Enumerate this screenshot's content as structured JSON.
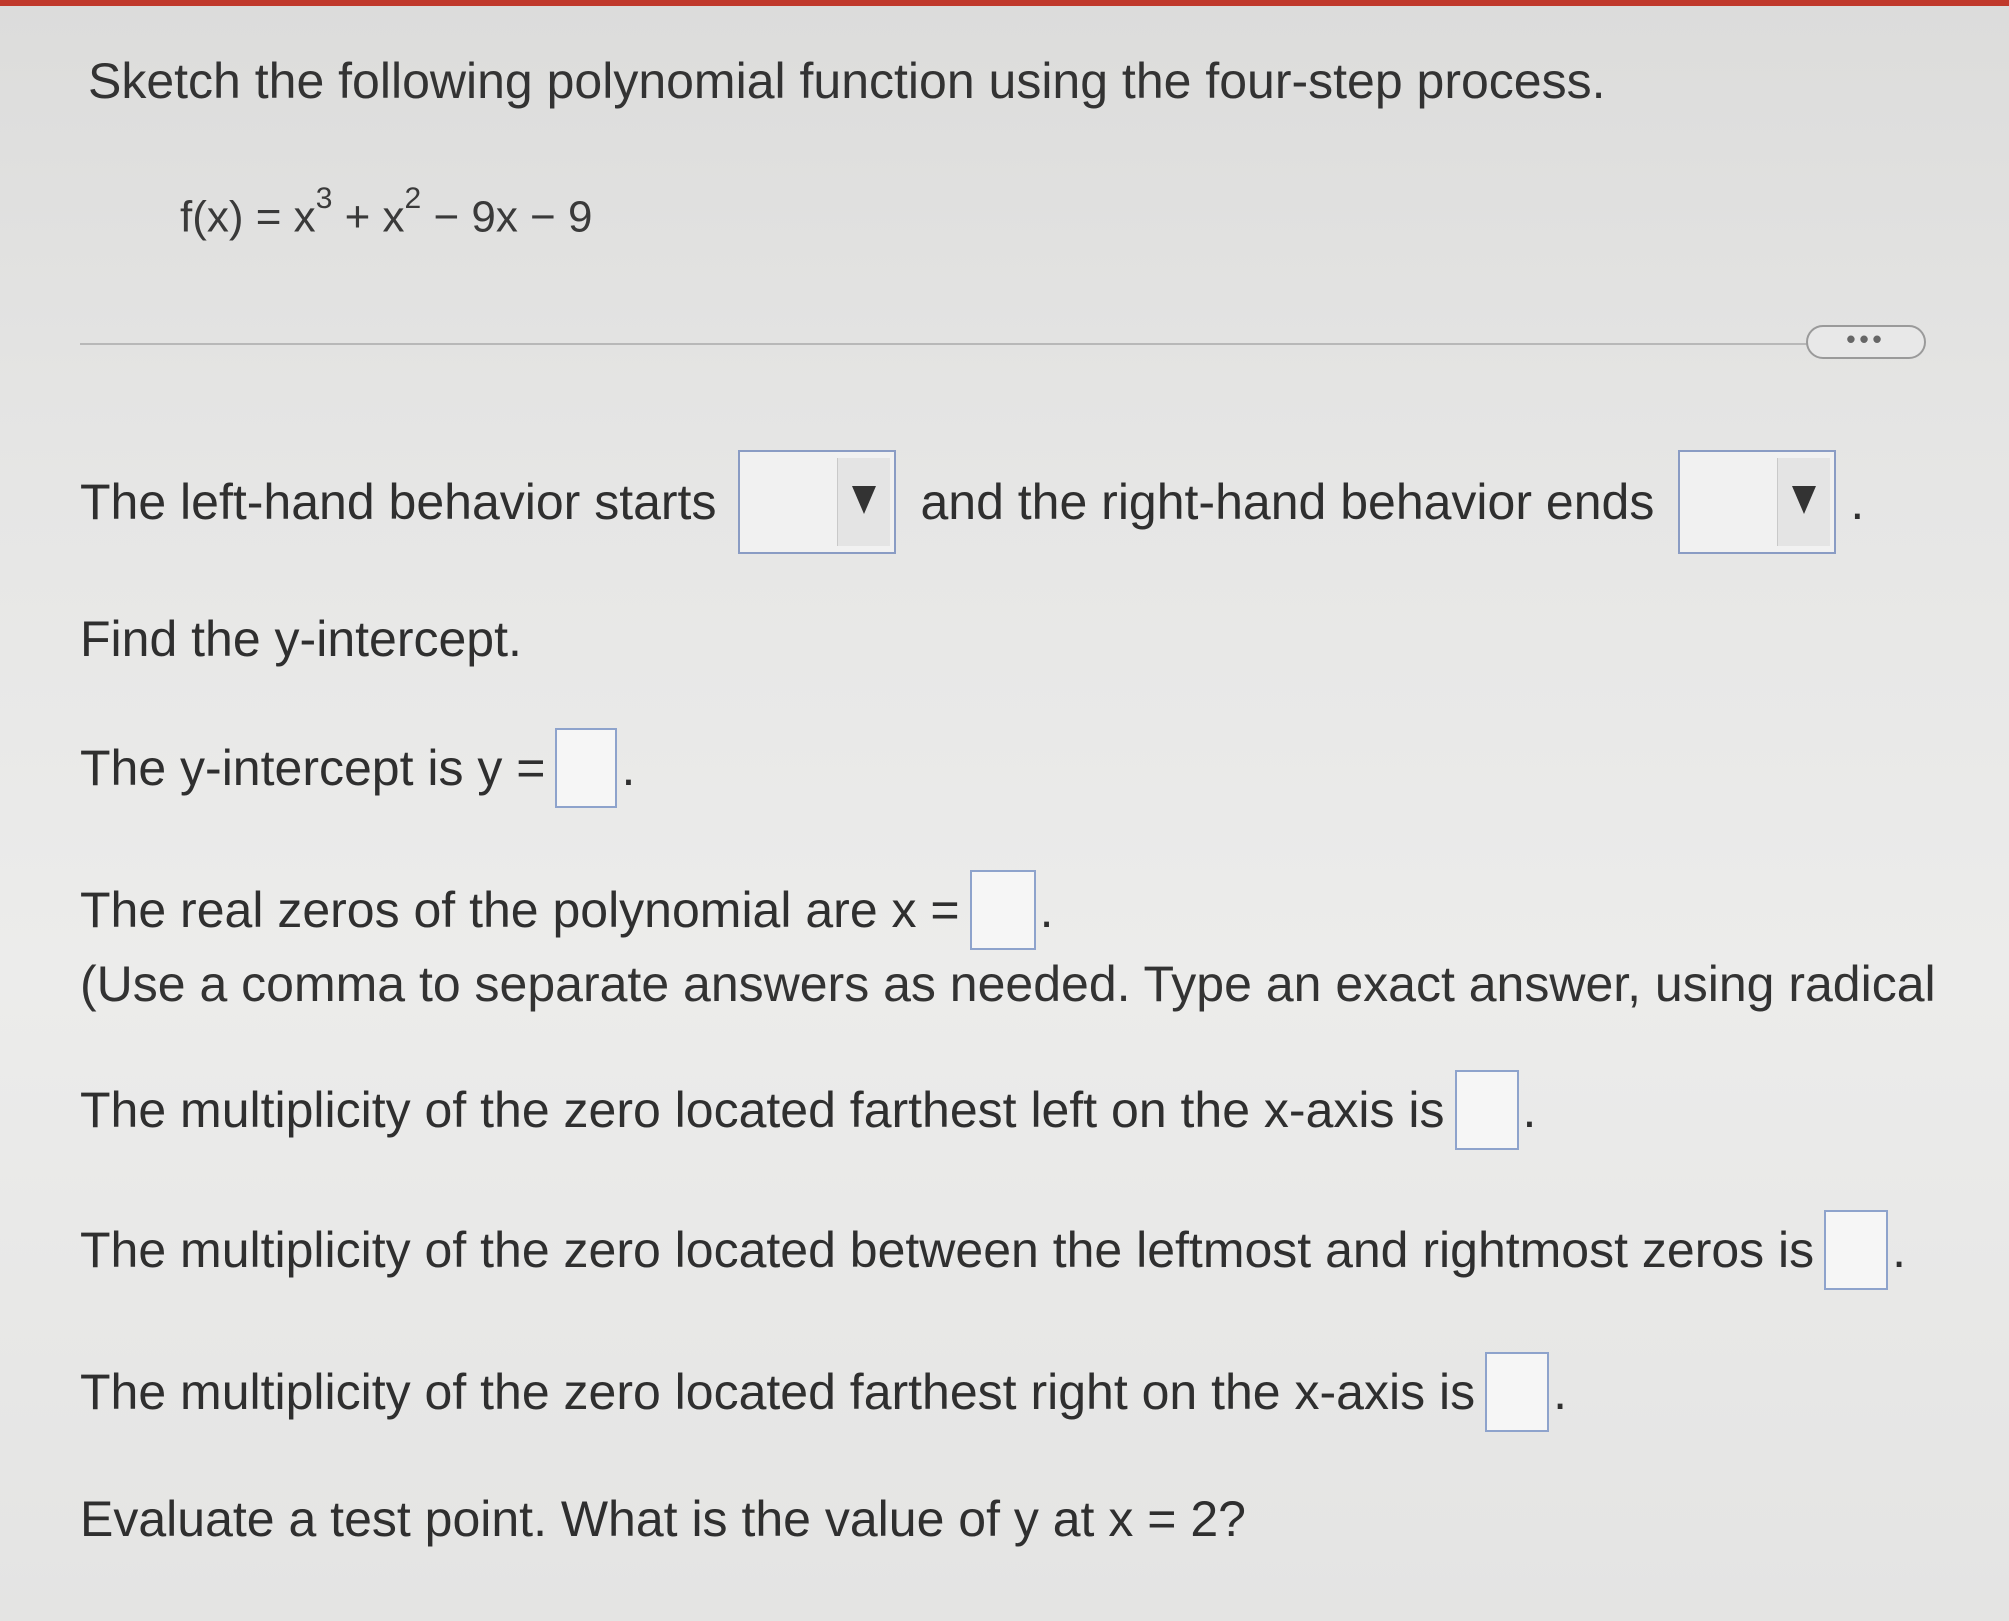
{
  "question": {
    "instruction": "Sketch the following polynomial function using the four-step process.",
    "function_parts": {
      "lhs": "f(x) = x",
      "exp1": "3",
      "mid": " + x",
      "exp2": "2",
      "rhs": " − 9x − 9"
    },
    "more_label": "•••"
  },
  "behavior": {
    "left_text": "The left-hand behavior starts",
    "left_selected": "",
    "right_text": "and the right-hand behavior ends",
    "right_selected": "",
    "end_punct": "."
  },
  "y_intercept": {
    "prompt": "Find the y-intercept.",
    "label": "The y-intercept is y =",
    "value": "",
    "end_punct": "."
  },
  "zeros": {
    "label": "The real zeros of the polynomial are x =",
    "value": "",
    "end_punct": ".",
    "hint": "(Use a comma to separate answers as needed. Type an exact answer, using radical"
  },
  "multiplicity": {
    "left_label": "The multiplicity of the zero located farthest left on the x-axis is",
    "left_value": "",
    "middle_label": "The multiplicity of the zero located between the leftmost and rightmost zeros is",
    "middle_value": "",
    "right_label": "The multiplicity of the zero located farthest right on the x-axis is",
    "right_value": "",
    "end_punct": "."
  },
  "test_point": {
    "label": "Evaluate a test point. What is the value of y at x = 2?"
  }
}
